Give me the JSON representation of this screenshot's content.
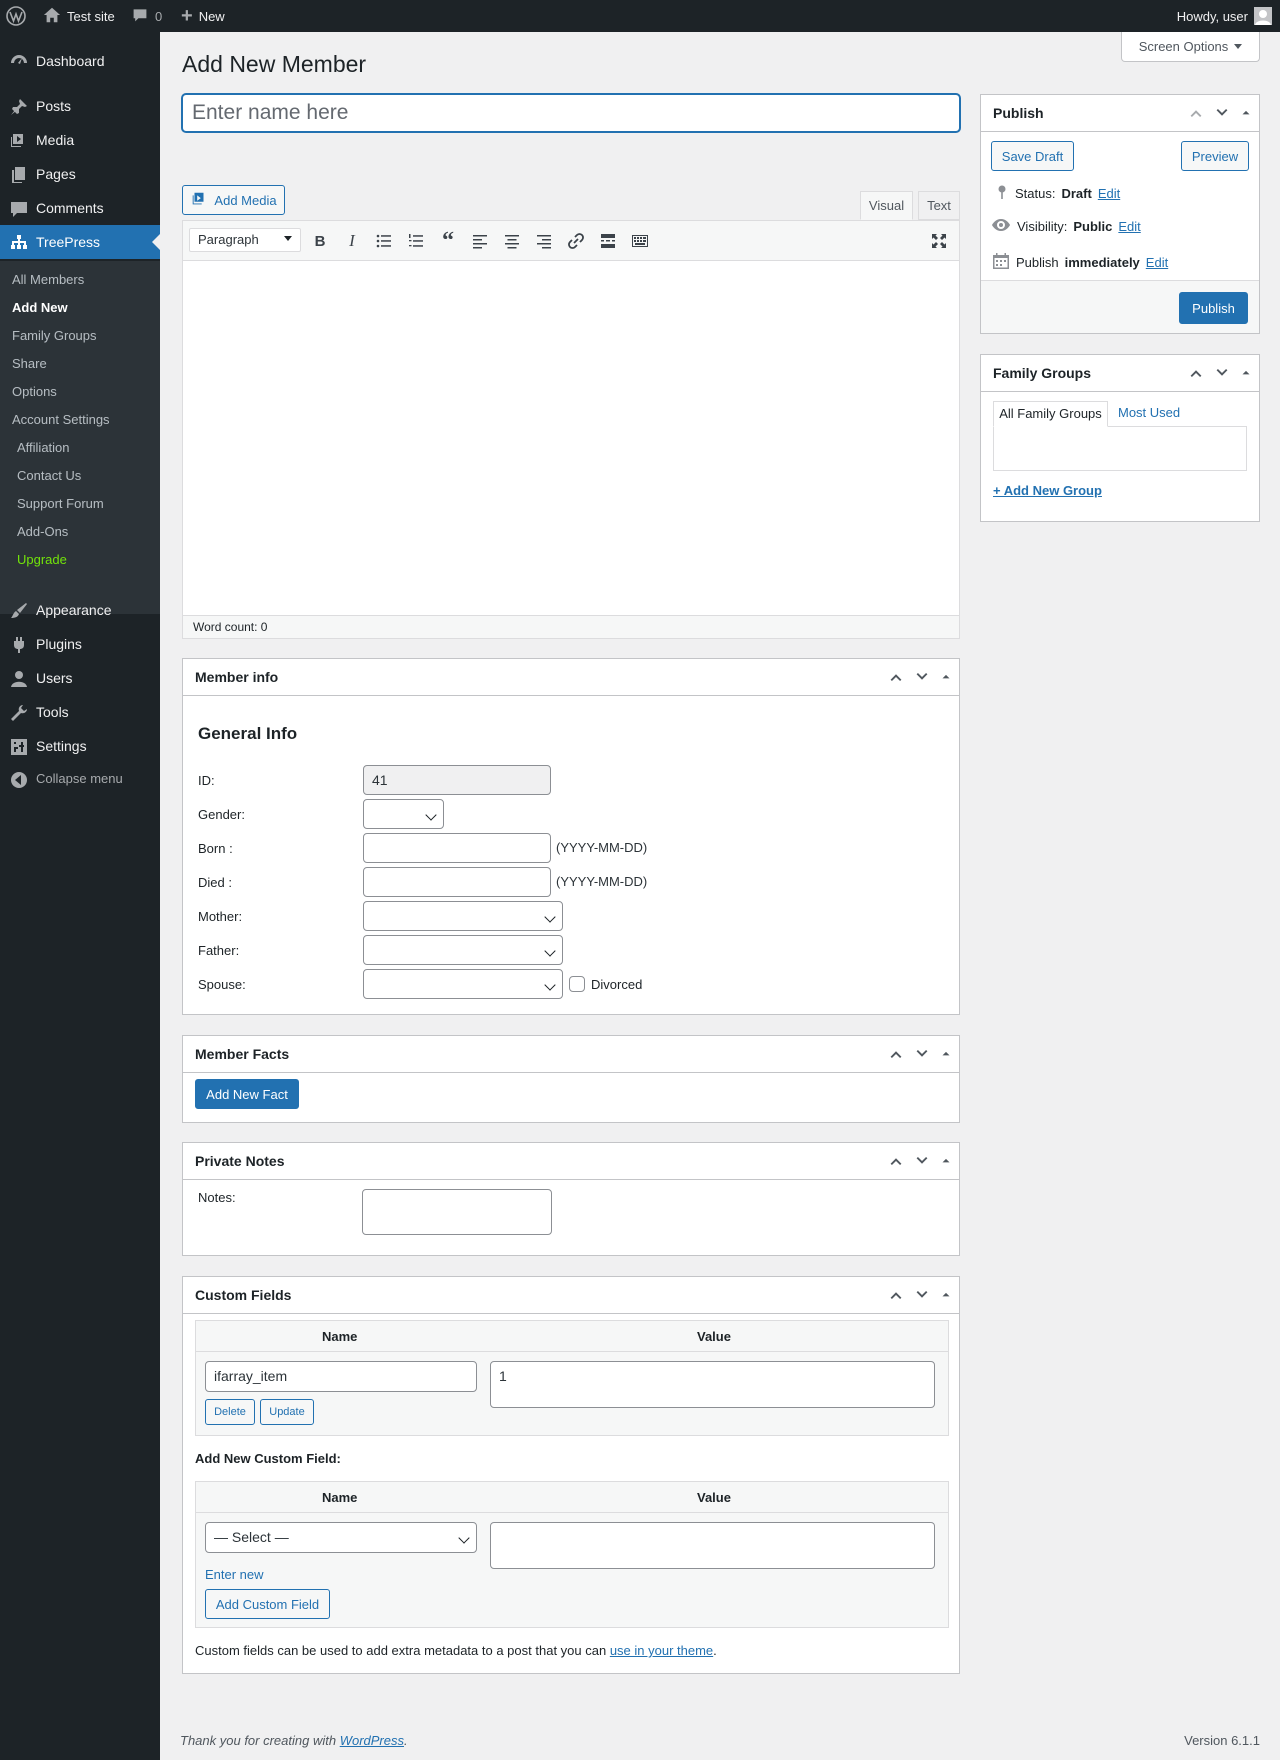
{
  "adminbar": {
    "site_name": "Test site",
    "comments_count": "0",
    "new_label": "New",
    "howdy": "Howdy, user"
  },
  "sidebar": {
    "items": [
      {
        "label": "Dashboard",
        "icon": "dashboard-icon"
      },
      {
        "label": "Posts",
        "icon": "pin-icon"
      },
      {
        "label": "Media",
        "icon": "media-icon"
      },
      {
        "label": "Pages",
        "icon": "pages-icon"
      },
      {
        "label": "Comments",
        "icon": "comment-icon"
      },
      {
        "label": "TreePress",
        "icon": "sitemap-icon"
      },
      {
        "label": "Appearance",
        "icon": "brush-icon"
      },
      {
        "label": "Plugins",
        "icon": "plug-icon"
      },
      {
        "label": "Users",
        "icon": "user-icon"
      },
      {
        "label": "Tools",
        "icon": "wrench-icon"
      },
      {
        "label": "Settings",
        "icon": "settings-icon"
      },
      {
        "label": "Collapse menu",
        "icon": "collapse-icon"
      }
    ],
    "submenu": [
      {
        "label": "All Members"
      },
      {
        "label": "Add New"
      },
      {
        "label": "Family Groups"
      },
      {
        "label": "Share"
      },
      {
        "label": "Options"
      },
      {
        "label": "Account Settings"
      },
      {
        "label": " Affiliation"
      },
      {
        "label": " Contact Us"
      },
      {
        "label": " Support Forum"
      },
      {
        "label": " Add-Ons"
      },
      {
        "label": " Upgrade  "
      }
    ]
  },
  "page": {
    "title": "Add New Member",
    "screen_options": "Screen Options",
    "name_placeholder": "Enter name here"
  },
  "editor": {
    "add_media": "Add Media",
    "tab_visual": "Visual",
    "tab_text": "Text",
    "format": "Paragraph",
    "word_count": "Word count: 0"
  },
  "publish": {
    "title": "Publish",
    "save_draft": "Save Draft",
    "preview": "Preview",
    "status_label": "Status:",
    "status_value": "Draft",
    "visibility_label": "Visibility:",
    "visibility_value": "Public",
    "publish_label": "Publish",
    "publish_value": "immediately",
    "edit": "Edit",
    "publish_button": "Publish"
  },
  "family_groups": {
    "title": "Family Groups",
    "tab_all": "All Family Groups",
    "tab_most_used": "Most Used",
    "add_new": "+ Add New Group"
  },
  "member_info": {
    "title": "Member info",
    "heading": "General Info",
    "id_label": "ID:",
    "id_value": "41",
    "gender_label": "Gender:",
    "born_label": "Born :",
    "died_label": "Died :",
    "date_hint": "(YYYY-MM-DD)",
    "mother_label": "Mother:",
    "father_label": "Father:",
    "spouse_label": "Spouse:",
    "divorced_label": "Divorced"
  },
  "member_facts": {
    "title": "Member Facts",
    "add_button": "Add New Fact"
  },
  "private_notes": {
    "title": "Private Notes",
    "notes_label": "Notes:"
  },
  "custom_fields": {
    "title": "Custom Fields",
    "col_name": "Name",
    "col_value": "Value",
    "existing_name": "ifarray_item",
    "existing_value": "1",
    "delete": "Delete",
    "update": "Update",
    "add_new_heading": "Add New Custom Field:",
    "select_placeholder": "— Select —",
    "enter_new": "Enter new",
    "add_button": "Add Custom Field",
    "help_text": "Custom fields can be used to add extra metadata to a post that you can",
    "help_link": "use in your theme",
    "help_end": "."
  },
  "footer": {
    "thanks": "Thank you for creating with",
    "wp_link": "WordPress",
    "dot": ".",
    "version": "Version 6.1.1"
  }
}
